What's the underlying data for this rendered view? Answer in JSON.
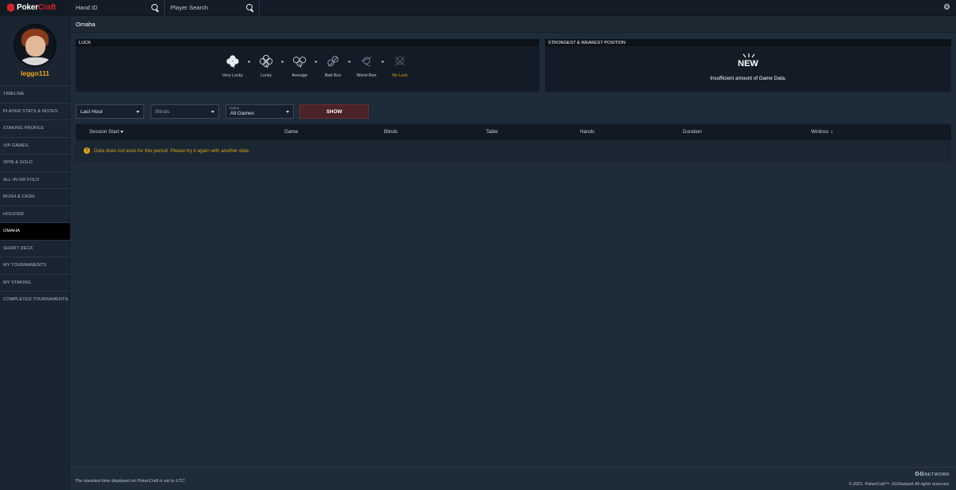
{
  "brand": {
    "name_part1": "Poker",
    "name_part2": "Craft",
    "accent": "#d2232a"
  },
  "search": {
    "hand_placeholder": "Hand ID",
    "player_placeholder": "Player Search"
  },
  "user": {
    "name": "leggo111"
  },
  "sidebar": {
    "items": [
      {
        "label": "TIMELINE"
      },
      {
        "label": "PLAYER STATS & NOTES"
      },
      {
        "label": "STAKING PROFILE"
      },
      {
        "label": "VIP GAMES"
      },
      {
        "label": "SPIN & GOLD"
      },
      {
        "label": "ALL-IN OR FOLD"
      },
      {
        "label": "RUSH & CASH"
      },
      {
        "label": "HOLD'EM"
      },
      {
        "label": "OMAHA"
      },
      {
        "label": "SHORT DECK"
      },
      {
        "label": "MY TOURNAMENTS"
      },
      {
        "label": "MY STAKING"
      },
      {
        "label": "COMPLETED TOURNAMENTS"
      }
    ],
    "active_index": 8
  },
  "page": {
    "title": "Omaha"
  },
  "luck": {
    "header": "LUCK",
    "steps": [
      {
        "label": "Very Lucky",
        "icon": "clover-full-icon"
      },
      {
        "label": "Lucky",
        "icon": "clover-outline-icon"
      },
      {
        "label": "Average",
        "icon": "clover-three-icon"
      },
      {
        "label": "Bad Run",
        "icon": "clover-two-icon"
      },
      {
        "label": "Worst Run",
        "icon": "clover-one-icon"
      },
      {
        "label": "No Luck",
        "icon": "clover-none-icon"
      }
    ]
  },
  "position": {
    "header": "STRONGEST & WEAKEST POSITION",
    "badge": "NEW",
    "message": "Insufficient amount of Game Data."
  },
  "filters": {
    "period": "Last Hour",
    "blinds_placeholder": "Blinds",
    "game_label": "Game",
    "game_value": "All Games",
    "show_label": "SHOW"
  },
  "table": {
    "columns": [
      "Session Start",
      "Game",
      "Blinds",
      "Table",
      "Hands",
      "Duration",
      "Winloss"
    ],
    "empty_message": "Data does not exist for this period. Please try it again with another date."
  },
  "footer": {
    "note": "The standard time displayed on PokerCraft is set to UTC.",
    "logo_part1": "GG",
    "logo_part2": "NETWORK",
    "copyright": "© 2021. PokerCraft™. GGNetwork All rights reserved."
  }
}
